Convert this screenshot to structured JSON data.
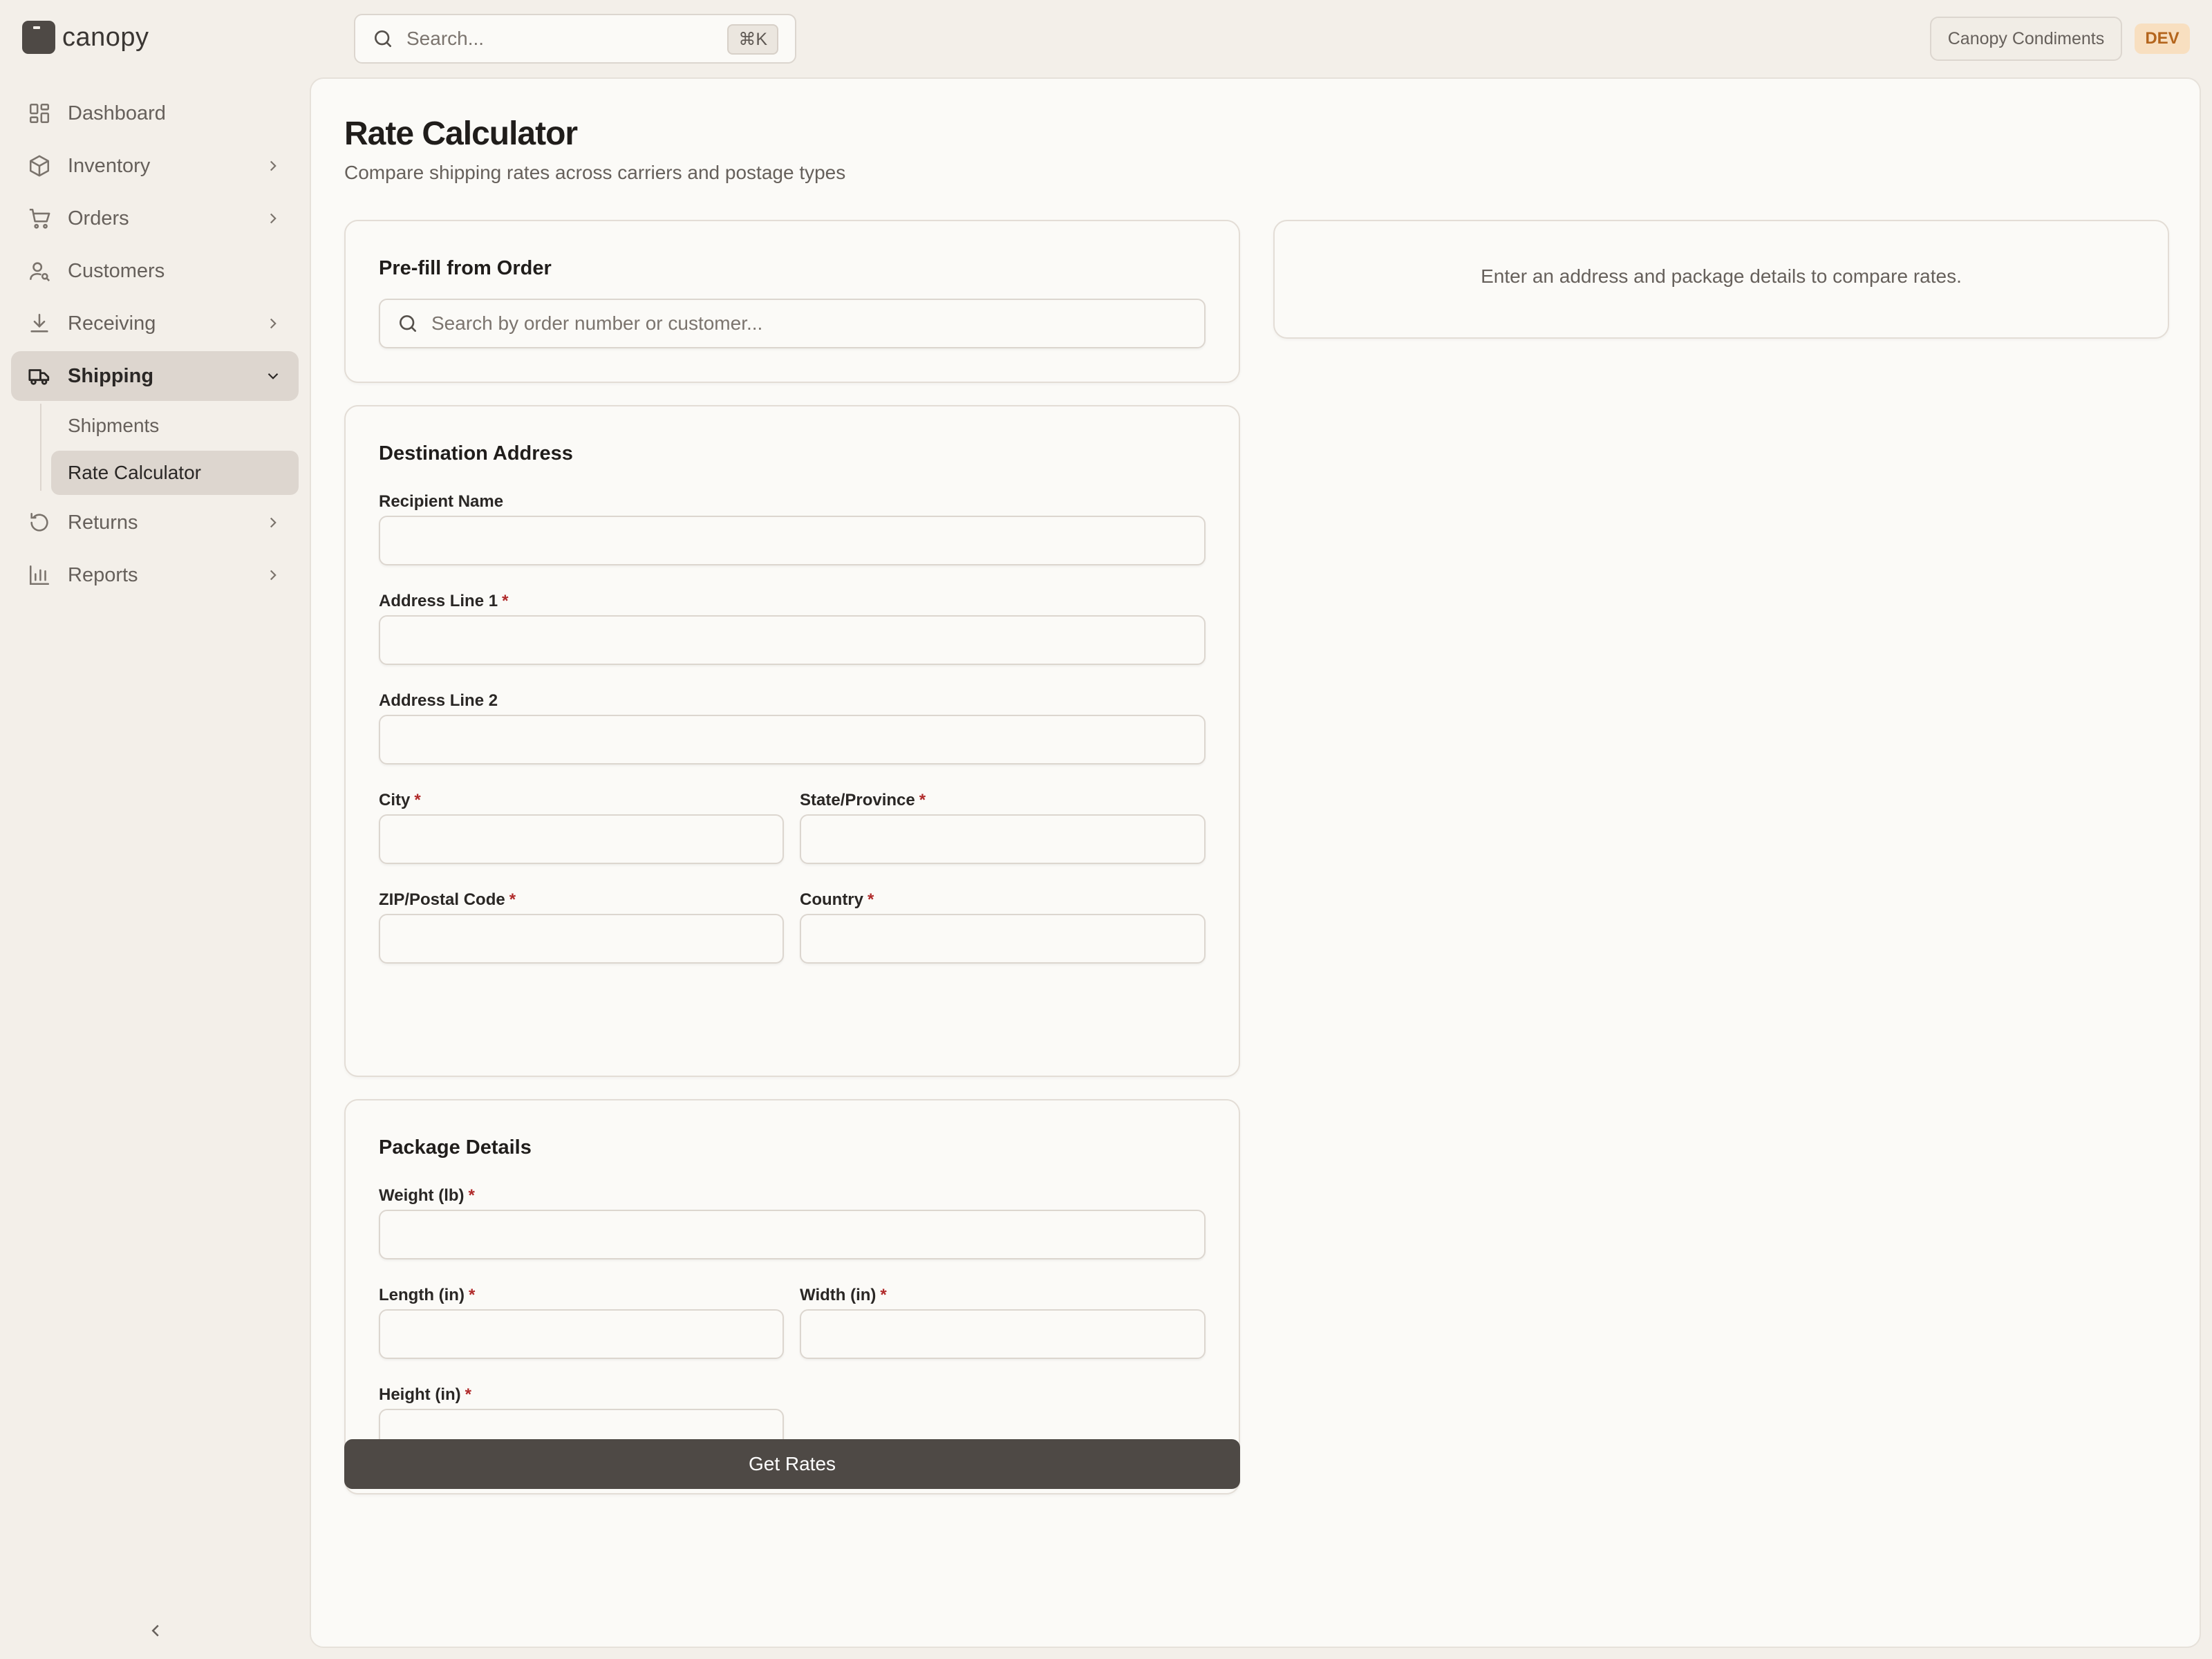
{
  "brand": {
    "name": "canopy"
  },
  "sidebar": {
    "items": [
      {
        "label": "Dashboard",
        "icon": "dashboard-icon"
      },
      {
        "label": "Inventory",
        "icon": "box-icon"
      },
      {
        "label": "Orders",
        "icon": "cart-icon"
      },
      {
        "label": "Customers",
        "icon": "customers-icon"
      },
      {
        "label": "Receiving",
        "icon": "download-icon"
      },
      {
        "label": "Shipping",
        "icon": "truck-icon",
        "expanded": true,
        "active": true
      },
      {
        "label": "Returns",
        "icon": "returns-icon"
      },
      {
        "label": "Reports",
        "icon": "bar-chart-icon"
      }
    ],
    "shipping_sub": [
      {
        "label": "Shipments"
      },
      {
        "label": "Rate Calculator",
        "active": true
      }
    ]
  },
  "topbar": {
    "search_placeholder": "Search...",
    "shortcut": "⌘K",
    "org": "Canopy Condiments",
    "env": "DEV"
  },
  "page": {
    "title": "Rate Calculator",
    "subtitle": "Compare shipping rates across carriers and postage types"
  },
  "prefill": {
    "title": "Pre-fill from Order",
    "placeholder": "Search by order number or customer..."
  },
  "destination": {
    "title": "Destination Address",
    "recipient": "Recipient Name",
    "line1": "Address Line 1",
    "line2": "Address Line 2",
    "city": "City",
    "state": "State/Province",
    "zip": "ZIP/Postal Code",
    "country": "Country"
  },
  "package": {
    "title": "Package Details",
    "weight": "Weight (lb)",
    "length": "Length (in)",
    "width": "Width (in)",
    "height": "Height (in)"
  },
  "actions": {
    "get_rates": "Get Rates"
  },
  "results": {
    "empty": "Enter an address and package details to compare rates."
  },
  "colors": {
    "accent": "#4e4945",
    "required": "#b02a2a",
    "env_badge": "#f8dfc0"
  }
}
